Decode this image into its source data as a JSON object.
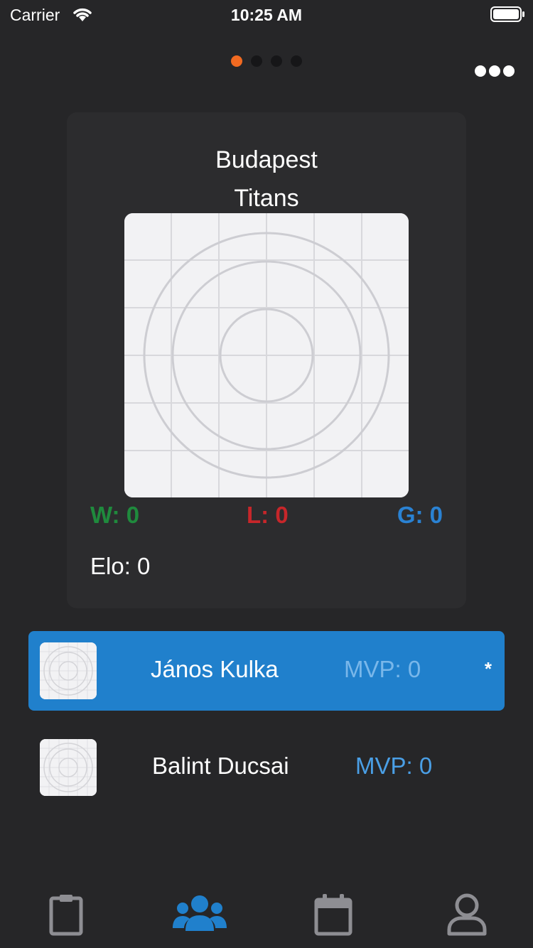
{
  "status_bar": {
    "carrier": "Carrier",
    "time": "10:25 AM"
  },
  "pager": {
    "pages": 4,
    "active_index": 0,
    "active_color": "#f16a21"
  },
  "more_button": {
    "icon": "more-horizontal-icon"
  },
  "team": {
    "name_line1": "Budapest",
    "name_line2": "Titans",
    "logo_icon": "placeholder-image-icon",
    "wins": "W: 0",
    "losses": "L: 0",
    "games": "G: 0",
    "elo": "Elo: 0",
    "colors": {
      "wins": "#1f8a3d",
      "losses": "#c7262a",
      "games": "#2a82d3"
    }
  },
  "players": [
    {
      "name": "János Kulka",
      "mvp": "MVP: 0",
      "captain_mark": "*",
      "selected": true
    },
    {
      "name": "Balint Ducsai",
      "mvp": "MVP: 0",
      "selected": false
    }
  ],
  "tab_bar": {
    "active_index": 1,
    "active_color": "#2080cc",
    "inactive_color": "#8e8e93",
    "tabs": [
      {
        "icon": "clipboard-icon"
      },
      {
        "icon": "users-icon"
      },
      {
        "icon": "calendar-icon"
      },
      {
        "icon": "user-profile-icon"
      }
    ]
  }
}
